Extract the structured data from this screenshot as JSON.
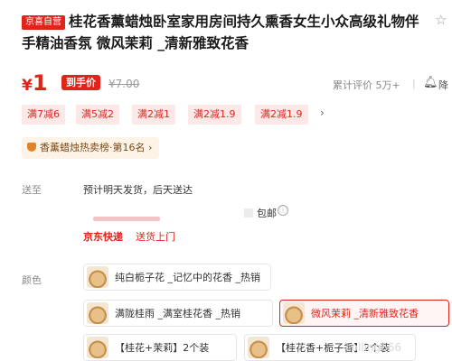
{
  "product": {
    "badge": "京喜自营",
    "title": "桂花香薰蜡烛卧室家用房间持久熏香女生小众高级礼物伴手精油香氛 微风茉莉 _清新雅致花香"
  },
  "price": {
    "currency": "¥",
    "value": "1",
    "tag": "到手价",
    "original": "¥7.00",
    "reviews": "累计评价 5万+",
    "notify_label": "降"
  },
  "coupons": [
    "满7减6",
    "满5减2",
    "满2减1",
    "满2减1.9",
    "满2减1.9"
  ],
  "coupon_more": "›",
  "ranking": "香薰蜡烛热卖榜·第16名 ›",
  "shipping": {
    "label": "送至",
    "delivery_time": "预计明天发货，后天送达",
    "free_shipping": "包邮",
    "info_icon": "ⓘ",
    "carrier": "京东快递",
    "door": "送货上门"
  },
  "colors": {
    "label": "颜色",
    "options": [
      {
        "label": "纯白栀子花 _记忆中的花香 _热销",
        "selected": false
      },
      {
        "label": "满陇桂雨 _满室桂花香 _热销",
        "selected": false
      },
      {
        "label": "微风茉莉 _清新雅致花香",
        "selected": true
      },
      {
        "label": "【桂花+茉莉】2个装",
        "selected": false
      },
      {
        "label": "【桂花香+栀子香】2个装",
        "selected": false
      }
    ]
  },
  "watermark": "colling666",
  "accent": "#e2231a"
}
